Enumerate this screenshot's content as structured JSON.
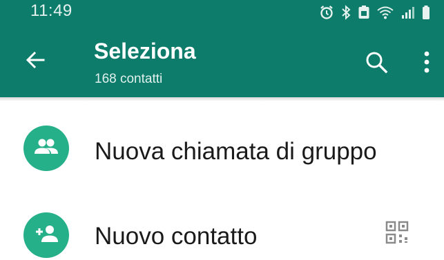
{
  "status_bar": {
    "time": "11:49",
    "icons": [
      "alarm-icon",
      "bluetooth-icon",
      "battery-saver-icon",
      "wifi-icon",
      "signal-icon",
      "battery-icon"
    ]
  },
  "header": {
    "title": "Seleziona",
    "subtitle": "168 contatti",
    "back_icon": "arrow-left-icon",
    "search_icon": "search-icon",
    "more_icon": "more-vertical-icon"
  },
  "list": {
    "items": [
      {
        "label": "Nuova chiamata di gruppo",
        "icon": "group-icon"
      },
      {
        "label": "Nuovo contatto",
        "icon": "add-person-icon",
        "trailing_icon": "qr-code-icon"
      }
    ]
  },
  "colors": {
    "header_bg": "#0d7c6a",
    "accent": "#25b089",
    "text": "#1a1a1a"
  }
}
